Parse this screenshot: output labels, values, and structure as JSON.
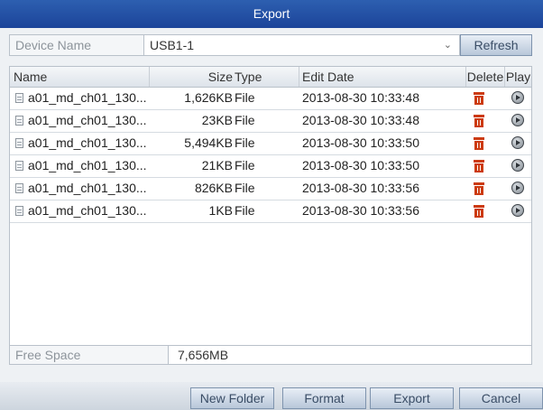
{
  "window": {
    "title": "Export"
  },
  "device": {
    "label": "Device Name",
    "value": "USB1-1",
    "refresh_label": "Refresh"
  },
  "table": {
    "headers": {
      "name": "Name",
      "size": "Size",
      "type": "Type",
      "edit_date": "Edit Date",
      "delete": "Delete",
      "play": "Play"
    },
    "rows": [
      {
        "name": "a01_md_ch01_130...",
        "size": "1,626KB",
        "type": "File",
        "date": "2013-08-30 10:33:48"
      },
      {
        "name": "a01_md_ch01_130...",
        "size": "23KB",
        "type": "File",
        "date": "2013-08-30 10:33:48"
      },
      {
        "name": "a01_md_ch01_130...",
        "size": "5,494KB",
        "type": "File",
        "date": "2013-08-30 10:33:50"
      },
      {
        "name": "a01_md_ch01_130...",
        "size": "21KB",
        "type": "File",
        "date": "2013-08-30 10:33:50"
      },
      {
        "name": "a01_md_ch01_130...",
        "size": "826KB",
        "type": "File",
        "date": "2013-08-30 10:33:56"
      },
      {
        "name": "a01_md_ch01_130...",
        "size": "1KB",
        "type": "File",
        "date": "2013-08-30 10:33:56"
      }
    ]
  },
  "free_space": {
    "label": "Free Space",
    "value": "7,656MB"
  },
  "buttons": {
    "new_folder": "New Folder",
    "format": "Format",
    "export": "Export",
    "cancel": "Cancel"
  },
  "icons": {
    "file": "file-icon",
    "delete": "trash-icon",
    "play": "play-icon",
    "dropdown": "chevron-down-icon"
  },
  "colors": {
    "title_bar": "#2557a8",
    "delete_icon": "#cc3a10"
  }
}
